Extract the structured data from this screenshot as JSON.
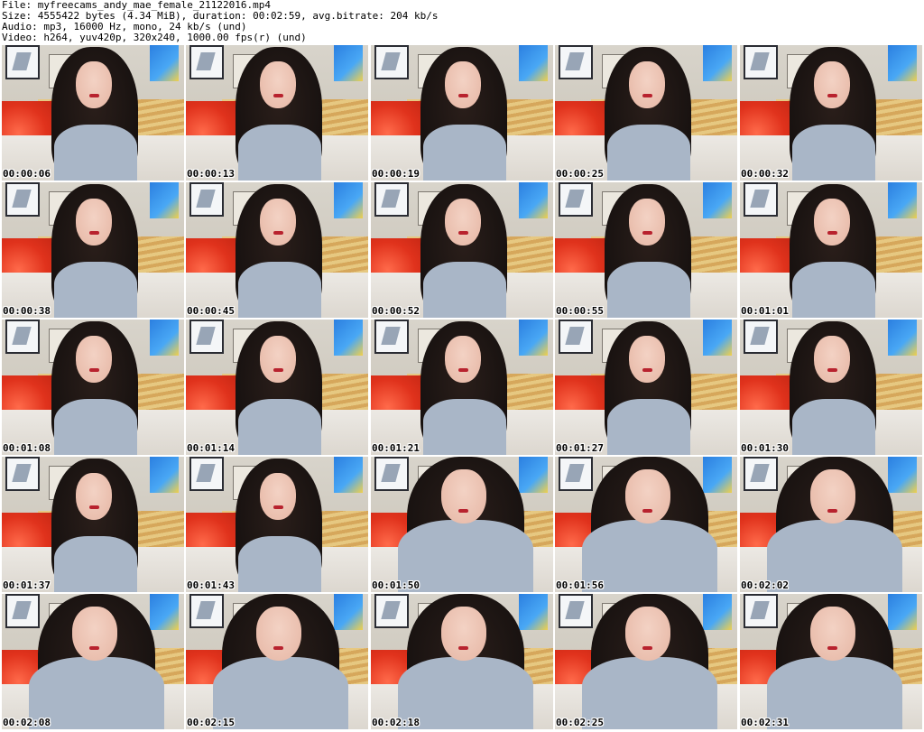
{
  "header": {
    "file_line": "File: myfreecams_andy_mae_female_21122016.mp4",
    "size_line": "Size: 4555422 bytes (4.34 MiB), duration: 00:02:59, avg.bitrate: 204 kb/s",
    "audio_line": "Audio: mp3, 16000 Hz, mono, 24 kb/s (und)",
    "video_line": "Video: h264, yuv420p, 320x240, 1000.00 fps(r) (und)"
  },
  "thumbnails": [
    {
      "time": "00:00:06",
      "scene": "normal"
    },
    {
      "time": "00:00:13",
      "scene": "normal"
    },
    {
      "time": "00:00:19",
      "scene": "normal"
    },
    {
      "time": "00:00:25",
      "scene": "normal"
    },
    {
      "time": "00:00:32",
      "scene": "normal"
    },
    {
      "time": "00:00:38",
      "scene": "normal"
    },
    {
      "time": "00:00:45",
      "scene": "normal"
    },
    {
      "time": "00:00:52",
      "scene": "normal"
    },
    {
      "time": "00:00:55",
      "scene": "normal"
    },
    {
      "time": "00:01:01",
      "scene": "normal"
    },
    {
      "time": "00:01:08",
      "scene": "normal"
    },
    {
      "time": "00:01:14",
      "scene": "normal"
    },
    {
      "time": "00:01:21",
      "scene": "normal"
    },
    {
      "time": "00:01:27",
      "scene": "normal"
    },
    {
      "time": "00:01:30",
      "scene": "normal"
    },
    {
      "time": "00:01:37",
      "scene": "normal"
    },
    {
      "time": "00:01:43",
      "scene": "normal"
    },
    {
      "time": "00:01:50",
      "scene": "close"
    },
    {
      "time": "00:01:56",
      "scene": "close"
    },
    {
      "time": "00:02:02",
      "scene": "close"
    },
    {
      "time": "00:02:08",
      "scene": "close"
    },
    {
      "time": "00:02:15",
      "scene": "close"
    },
    {
      "time": "00:02:18",
      "scene": "close"
    },
    {
      "time": "00:02:25",
      "scene": "close"
    },
    {
      "time": "00:02:31",
      "scene": "close"
    }
  ],
  "colors": {
    "background": "#ffffff",
    "text": "#000000",
    "timestamp_outline": "#ffffff"
  }
}
